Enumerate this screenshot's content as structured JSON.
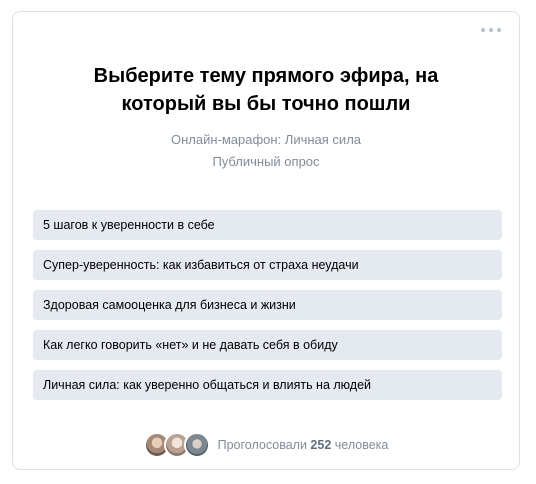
{
  "poll": {
    "title": "Выберите тему прямого эфира, на который вы бы точно пошли",
    "author": "Онлайн-марафон: Личная сила",
    "type": "Публичный опрос",
    "options": [
      "5 шагов к уверенности в себе",
      "Супер-уверенность: как избавиться от страха неудачи",
      "Здоровая самооценка для бизнеса и жизни",
      "Как легко говорить «нет» и не давать себя в обиду",
      "Личная сила: как уверенно общаться и влиять на людей"
    ],
    "footer": {
      "voted_prefix": "Проголосовали",
      "voted_count": "252",
      "voted_suffix": "человека"
    }
  },
  "icons": {
    "more": "more-horizontal-icon"
  },
  "colors": {
    "option_bg": "#e5eaf0",
    "secondary_text": "#818c99",
    "border": "#dce1e6"
  }
}
